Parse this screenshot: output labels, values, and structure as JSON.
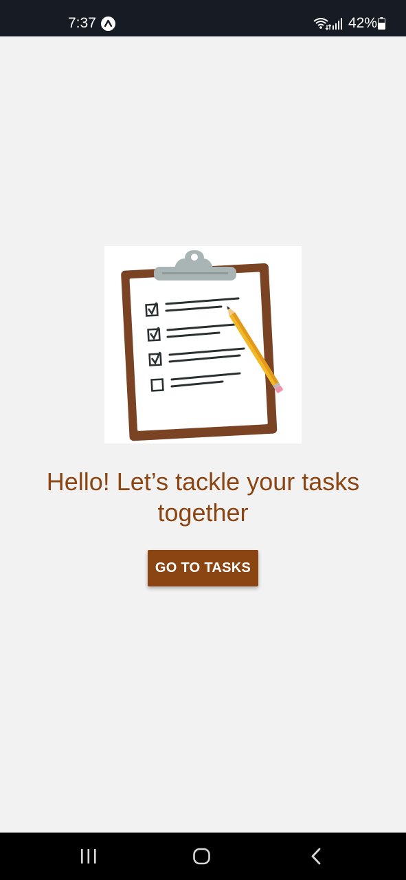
{
  "status_bar": {
    "time": "7:37",
    "battery_percent": "42%",
    "icons": [
      "app-notification-icon",
      "wifi-icon",
      "signal-icon",
      "battery-icon"
    ]
  },
  "main": {
    "illustration": "clipboard-checklist-icon",
    "title": "Hello! Let’s tackle your tasks together",
    "button_label": "GO TO TASKS"
  },
  "nav_bar": {
    "icons": [
      "recents-icon",
      "home-icon",
      "back-icon"
    ]
  },
  "colors": {
    "accent": "#8b4513",
    "background": "#f2f2f2",
    "status_bar": "#161b24",
    "nav_bar": "#000000"
  }
}
